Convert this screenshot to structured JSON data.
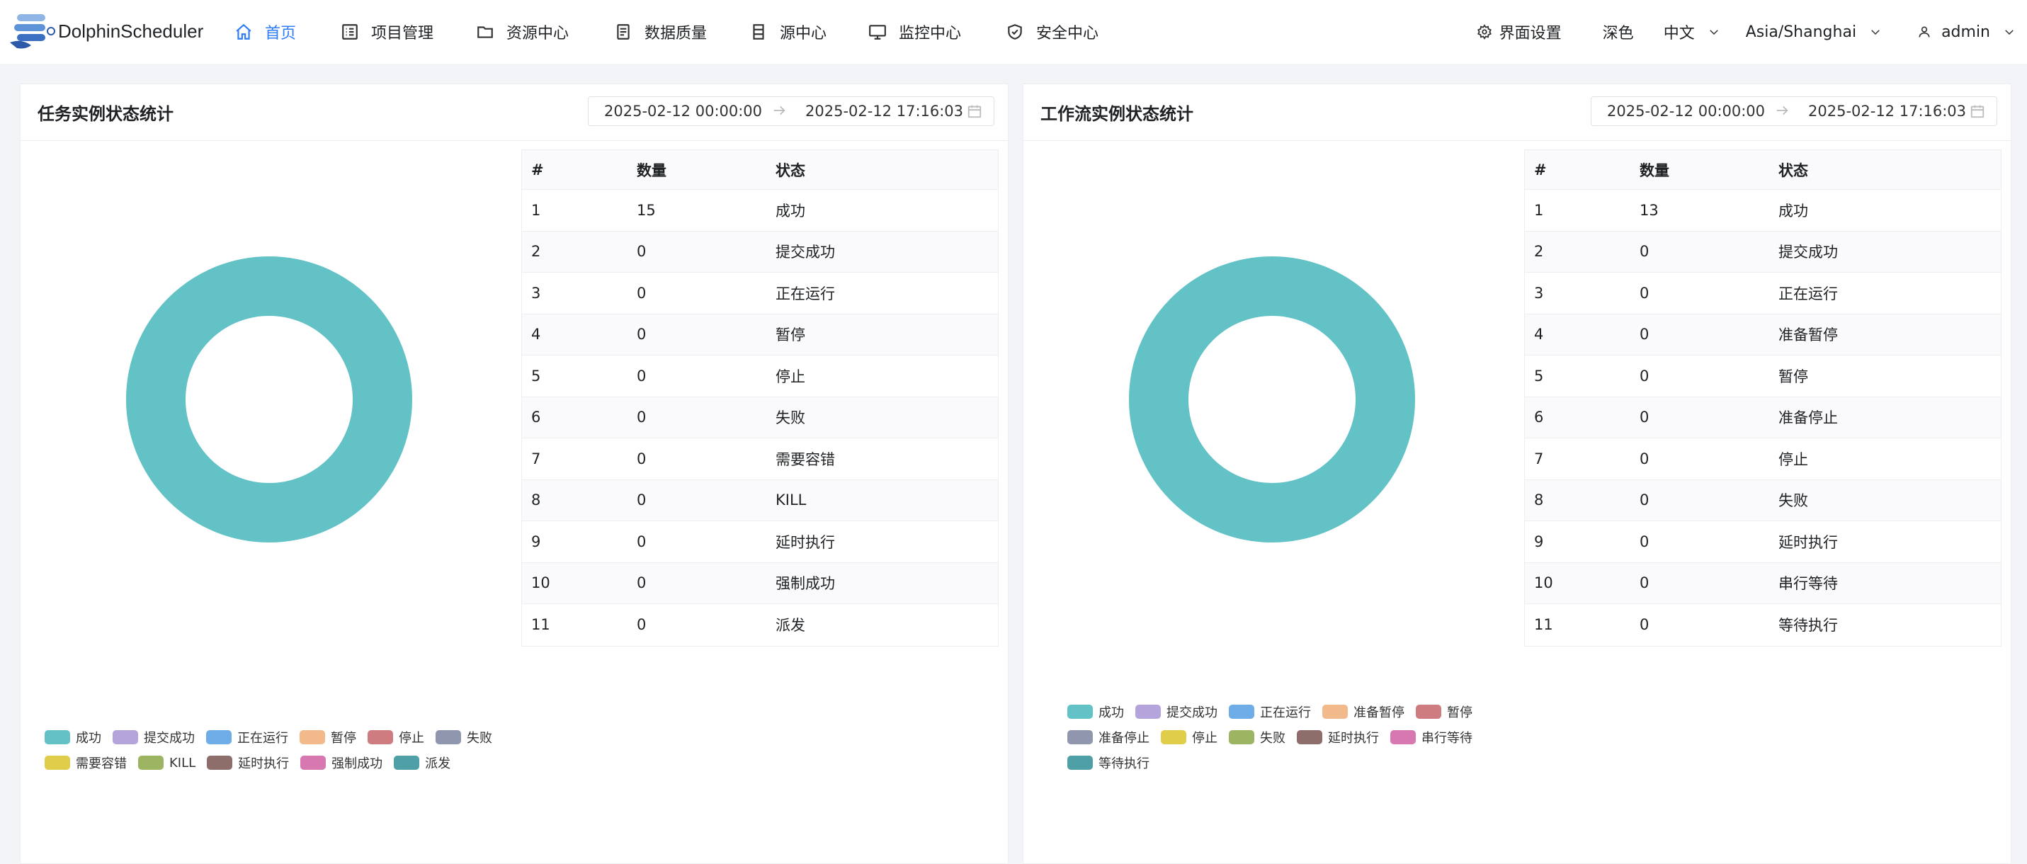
{
  "app": {
    "name": "DolphinScheduler"
  },
  "nav": [
    {
      "label": "首页",
      "icon": "home-icon",
      "active": true
    },
    {
      "label": "项目管理",
      "icon": "project-icon",
      "active": false
    },
    {
      "label": "资源中心",
      "icon": "folder-icon",
      "active": false
    },
    {
      "label": "数据质量",
      "icon": "data-quality-icon",
      "active": false
    },
    {
      "label": "源中心",
      "icon": "datasource-icon",
      "active": false
    },
    {
      "label": "监控中心",
      "icon": "monitor-icon",
      "active": false
    },
    {
      "label": "安全中心",
      "icon": "shield-icon",
      "active": false
    }
  ],
  "tools": {
    "settings_label": "界面设置",
    "theme_label": "深色",
    "language": "中文",
    "timezone": "Asia/Shanghai",
    "user": "admin"
  },
  "colors": {
    "accent": "#2e7cf6",
    "donut": "#63c2c5"
  },
  "task_panel": {
    "title": "任务实例状态统计",
    "start_date": "2025-02-12 00:00:00",
    "end_date": "2025-02-12 17:16:03",
    "headers": [
      "#",
      "数量",
      "状态"
    ],
    "rows": [
      [
        "1",
        "15",
        "成功"
      ],
      [
        "2",
        "0",
        "提交成功"
      ],
      [
        "3",
        "0",
        "正在运行"
      ],
      [
        "4",
        "0",
        "暂停"
      ],
      [
        "5",
        "0",
        "停止"
      ],
      [
        "6",
        "0",
        "失败"
      ],
      [
        "7",
        "0",
        "需要容错"
      ],
      [
        "8",
        "0",
        "KILL"
      ],
      [
        "9",
        "0",
        "延时执行"
      ],
      [
        "10",
        "0",
        "强制成功"
      ],
      [
        "11",
        "0",
        "派发"
      ]
    ],
    "legend": [
      {
        "label": "成功",
        "color": "#63c2c5"
      },
      {
        "label": "提交成功",
        "color": "#b5a3dc"
      },
      {
        "label": "正在运行",
        "color": "#6fade8"
      },
      {
        "label": "暂停",
        "color": "#f2b98a"
      },
      {
        "label": "停止",
        "color": "#cf7c80"
      },
      {
        "label": "失败",
        "color": "#8f96ad"
      },
      {
        "label": "需要容错",
        "color": "#e0cd4a"
      },
      {
        "label": "KILL",
        "color": "#9db563"
      },
      {
        "label": "延时执行",
        "color": "#8e6e6a"
      },
      {
        "label": "强制成功",
        "color": "#d878b0"
      },
      {
        "label": "派发",
        "color": "#4ea0a6"
      }
    ]
  },
  "workflow_panel": {
    "title": "工作流实例状态统计",
    "start_date": "2025-02-12 00:00:00",
    "end_date": "2025-02-12 17:16:03",
    "headers": [
      "#",
      "数量",
      "状态"
    ],
    "rows": [
      [
        "1",
        "13",
        "成功"
      ],
      [
        "2",
        "0",
        "提交成功"
      ],
      [
        "3",
        "0",
        "正在运行"
      ],
      [
        "4",
        "0",
        "准备暂停"
      ],
      [
        "5",
        "0",
        "暂停"
      ],
      [
        "6",
        "0",
        "准备停止"
      ],
      [
        "7",
        "0",
        "停止"
      ],
      [
        "8",
        "0",
        "失败"
      ],
      [
        "9",
        "0",
        "延时执行"
      ],
      [
        "10",
        "0",
        "串行等待"
      ],
      [
        "11",
        "0",
        "等待执行"
      ]
    ],
    "legend": [
      {
        "label": "成功",
        "color": "#63c2c5"
      },
      {
        "label": "提交成功",
        "color": "#b5a3dc"
      },
      {
        "label": "正在运行",
        "color": "#6fade8"
      },
      {
        "label": "准备暂停",
        "color": "#f2b98a"
      },
      {
        "label": "暂停",
        "color": "#cf7c80"
      },
      {
        "label": "准备停止",
        "color": "#8f96ad"
      },
      {
        "label": "停止",
        "color": "#e0cd4a"
      },
      {
        "label": "失败",
        "color": "#9db563"
      },
      {
        "label": "延时执行",
        "color": "#8e6e6a"
      },
      {
        "label": "串行等待",
        "color": "#d878b0"
      },
      {
        "label": "等待执行",
        "color": "#4ea0a6"
      }
    ]
  }
}
